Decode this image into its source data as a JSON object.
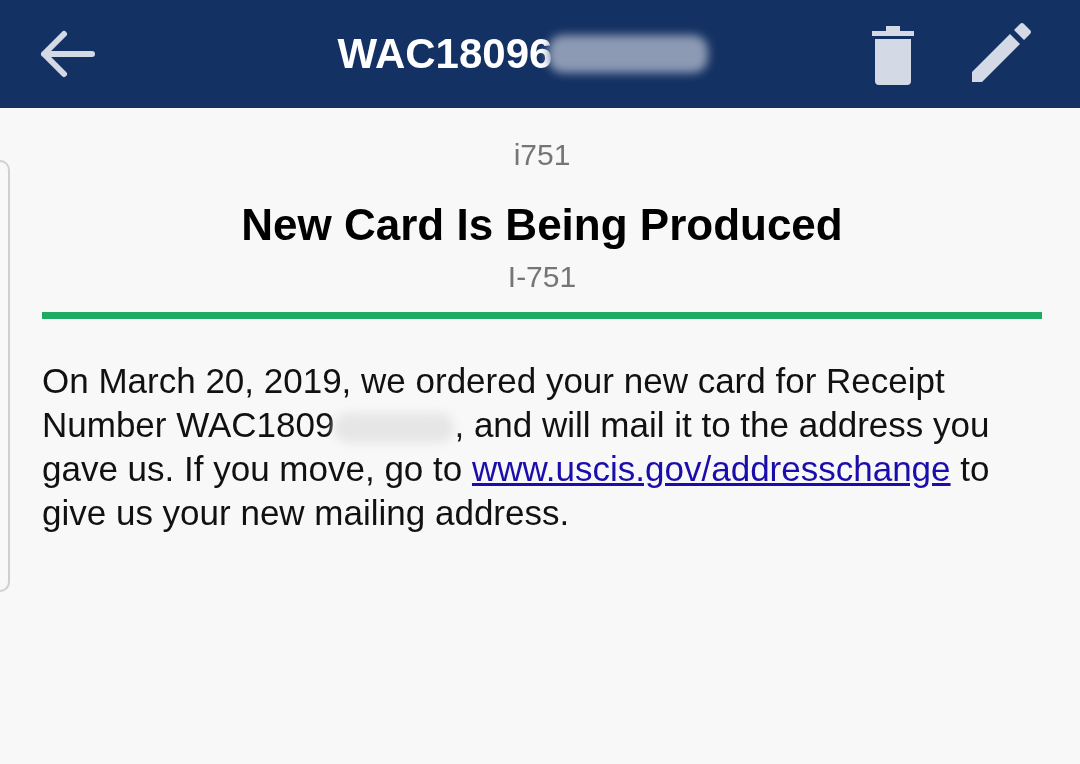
{
  "app_bar": {
    "title": "WAC18096",
    "title_redacted": true
  },
  "case": {
    "form_code": "i751",
    "status_title": "New Card Is Being Produced",
    "form_name": "I-751"
  },
  "message": {
    "before_redaction": "On March 20, 2019, we ordered your new card for Receipt Number WAC1809",
    "redacted": true,
    "after_redaction": ", and will mail it to the address you gave us. If you move, go to",
    "link": "www.uscis.gov/addresschange",
    "after_link": "to give us your new mailing address."
  }
}
